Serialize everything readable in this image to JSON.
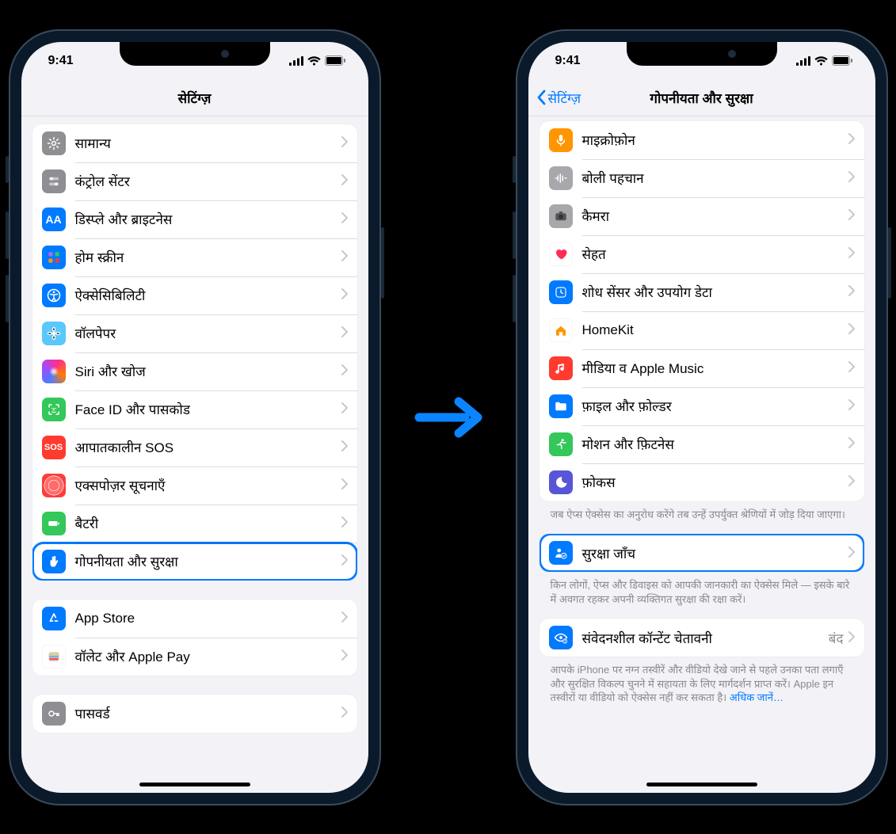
{
  "status": {
    "time": "9:41"
  },
  "left_phone": {
    "title": "सेटिंग्ज़",
    "group1": [
      {
        "label": "सामान्य",
        "icon": "gear",
        "bg": "bg-gray"
      },
      {
        "label": "कंट्रोल सेंटर",
        "icon": "switches",
        "bg": "bg-gray"
      },
      {
        "label": "डिस्प्ले और ब्राइटनेस",
        "icon": "AA",
        "bg": "bg-blue"
      },
      {
        "label": "होम स्क्रीन",
        "icon": "grid",
        "bg": "bg-blue"
      },
      {
        "label": "ऐक्सेसिबिलिटी",
        "icon": "accessibility",
        "bg": "bg-blue"
      },
      {
        "label": "वॉलपेपर",
        "icon": "flower",
        "bg": "bg-lblue"
      },
      {
        "label": "Siri और खोज",
        "icon": "siri",
        "bg": "bg-grad-siri"
      },
      {
        "label": "Face ID और पासकोड",
        "icon": "faceid",
        "bg": "bg-green"
      },
      {
        "label": "आपातकालीन SOS",
        "icon": "SOS",
        "bg": "bg-red"
      },
      {
        "label": "एक्सपोज़र सूचनाएँ",
        "icon": "exposure",
        "bg": "bg-exposure"
      },
      {
        "label": "बैटरी",
        "icon": "battery",
        "bg": "bg-green"
      },
      {
        "label": "गोपनीयता और सुरक्षा",
        "icon": "hand",
        "bg": "bg-blue",
        "highlight": true
      }
    ],
    "group2": [
      {
        "label": "App Store",
        "icon": "appstore",
        "bg": "bg-blue"
      },
      {
        "label": "वॉलेट और Apple Pay",
        "icon": "wallet",
        "bg": "bg-white"
      }
    ],
    "group3": [
      {
        "label": "पासवर्ड",
        "icon": "key",
        "bg": "bg-gray"
      }
    ]
  },
  "right_phone": {
    "back": "सेटिंग्ज़",
    "title": "गोपनीयता और सुरक्षा",
    "group1": [
      {
        "label": "माइक्रोफ़ोन",
        "icon": "mic",
        "bg": "bg-orange"
      },
      {
        "label": "बोली पहचान",
        "icon": "wave",
        "bg": "bg-gray2"
      },
      {
        "label": "कैमरा",
        "icon": "camera",
        "bg": "bg-gray2"
      },
      {
        "label": "सेहत",
        "icon": "heart",
        "bg": "bg-white"
      },
      {
        "label": "शोध सेंसर और उपयोग डेटा",
        "icon": "research",
        "bg": "bg-blue"
      },
      {
        "label": "HomeKit",
        "icon": "home",
        "bg": "bg-white"
      },
      {
        "label": "मीडिया व Apple Music",
        "icon": "music",
        "bg": "bg-red"
      },
      {
        "label": "फ़ाइल और फ़ोल्डर",
        "icon": "folder",
        "bg": "bg-blue"
      },
      {
        "label": "मोशन और फ़िटनेस",
        "icon": "runner",
        "bg": "bg-green"
      },
      {
        "label": "फ़ोकस",
        "icon": "moon",
        "bg": "bg-purple"
      }
    ],
    "group1_footer": "जब ऐप्स ऐक्सेस का अनुरोध करेंगे तब उन्हें उपर्युक्त श्रेणियों में जोड़ दिया जाएगा।",
    "group2": [
      {
        "label": "सुरक्षा जाँच",
        "icon": "safetycheck",
        "bg": "bg-blue",
        "highlight": true
      }
    ],
    "group2_footer": "किन लोगों, ऐप्स और डिवाइस को आपकी जानकारी का ऐक्सेस मिले — इसके बारे में अवगत रहकर अपनी व्यक्तिगत सुरक्षा की रक्षा करें।",
    "group3": [
      {
        "label": "संवेदनशील कॉन्टेंट चेतावनी",
        "icon": "eyewarn",
        "bg": "bg-blue",
        "detail": "बंद"
      }
    ],
    "group3_footer": "आपके iPhone पर नग्न तस्वीरें और वीडियो देखे जाने से पहले उनका पता लगाएँ और सुरक्षित विकल्प चुनने में सहायता के लिए मार्गदर्शन प्राप्त करें। Apple इन तस्वीरों या वीडियो को ऐक्सेस नहीं कर सकता है।",
    "learn_more": "अधिक जानें…"
  }
}
